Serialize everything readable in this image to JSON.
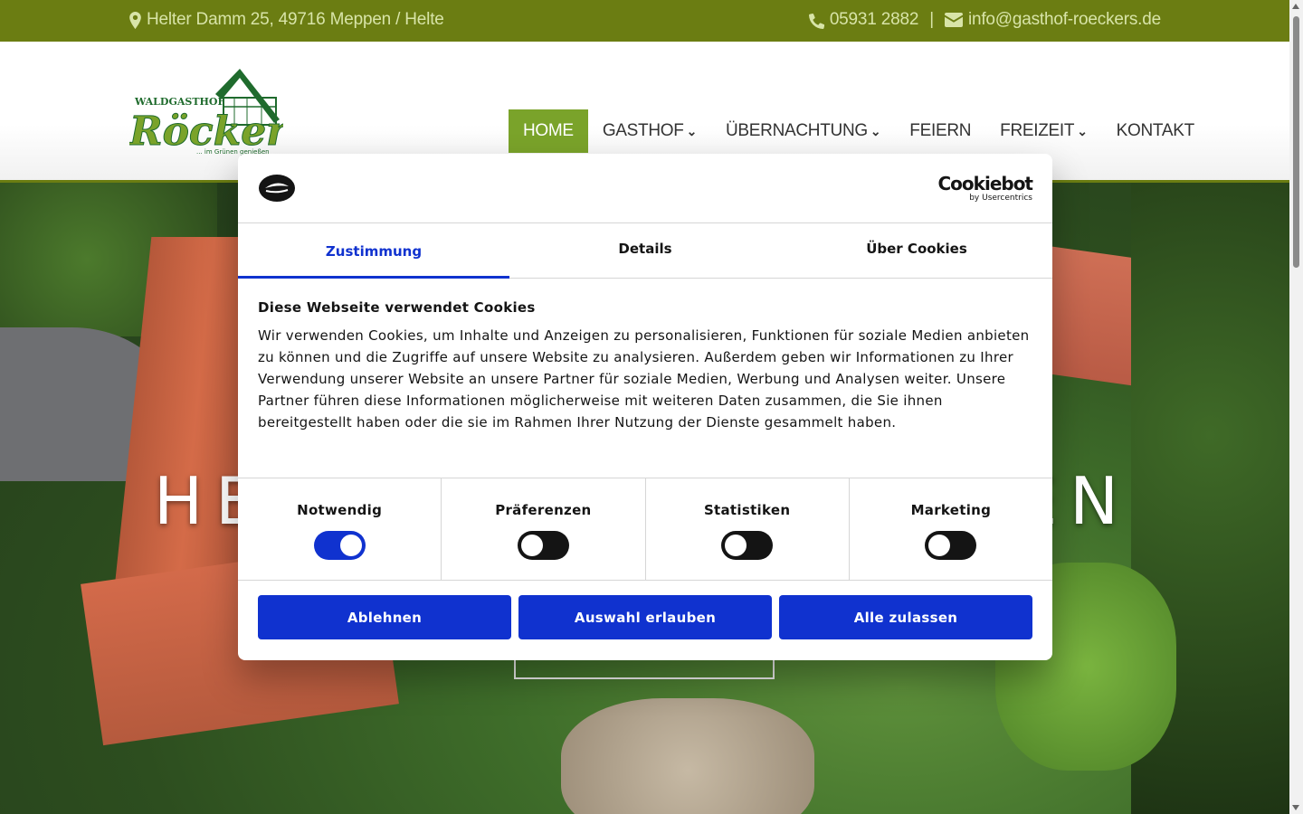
{
  "topbar": {
    "address": "Helter Damm 25, 49716 Meppen / Helte",
    "phone": "05931 2882",
    "separator": "|",
    "email": "info@gasthof-roeckers.de",
    "icons": [
      "map-pin-icon",
      "phone-icon",
      "envelope-icon"
    ],
    "bg_color": "#6b7d12"
  },
  "logo": {
    "top_text": "WALDGASTHOF",
    "name": "Röckers",
    "tagline": "... im Grünen genießen"
  },
  "nav": {
    "items": [
      {
        "label": "HOME",
        "active": true,
        "has_dropdown": false
      },
      {
        "label": "GASTHOF",
        "active": false,
        "has_dropdown": true
      },
      {
        "label": "ÜBERNACHTUNG",
        "active": false,
        "has_dropdown": true
      },
      {
        "label": "FEIERN",
        "active": false,
        "has_dropdown": false
      },
      {
        "label": "FREIZEIT",
        "active": false,
        "has_dropdown": true
      },
      {
        "label": "KONTAKT",
        "active": false,
        "has_dropdown": false
      }
    ],
    "active_color": "#7aa32a"
  },
  "hero": {
    "title_left": "HE",
    "title_right": "EN"
  },
  "cookie": {
    "brand": "Cookiebot",
    "brand_sub": "by Usercentrics",
    "tabs": [
      "Zustimmung",
      "Details",
      "Über Cookies"
    ],
    "active_tab": "Zustimmung",
    "title": "Diese Webseite verwendet Cookies",
    "text": "Wir verwenden Cookies, um Inhalte und Anzeigen zu personalisieren, Funktionen für soziale Medien anbieten zu können und die Zugriffe auf unsere Website zu analysieren. Außerdem geben wir Informationen zu Ihrer Verwendung unserer Website an unsere Partner für soziale Medien, Werbung und Analysen weiter. Unsere Partner führen diese Informationen möglicherweise mit weiteren Daten zusammen, die Sie ihnen bereitgestellt haben oder die sie im Rahmen Ihrer Nutzung der Dienste gesammelt haben.",
    "toggles": [
      {
        "label": "Notwendig",
        "on": true
      },
      {
        "label": "Präferenzen",
        "on": false
      },
      {
        "label": "Statistiken",
        "on": false
      },
      {
        "label": "Marketing",
        "on": false
      }
    ],
    "buttons": {
      "decline": "Ablehnen",
      "allow_selection": "Auswahl erlauben",
      "allow_all": "Alle zulassen"
    },
    "accent_color": "#1032cf"
  }
}
